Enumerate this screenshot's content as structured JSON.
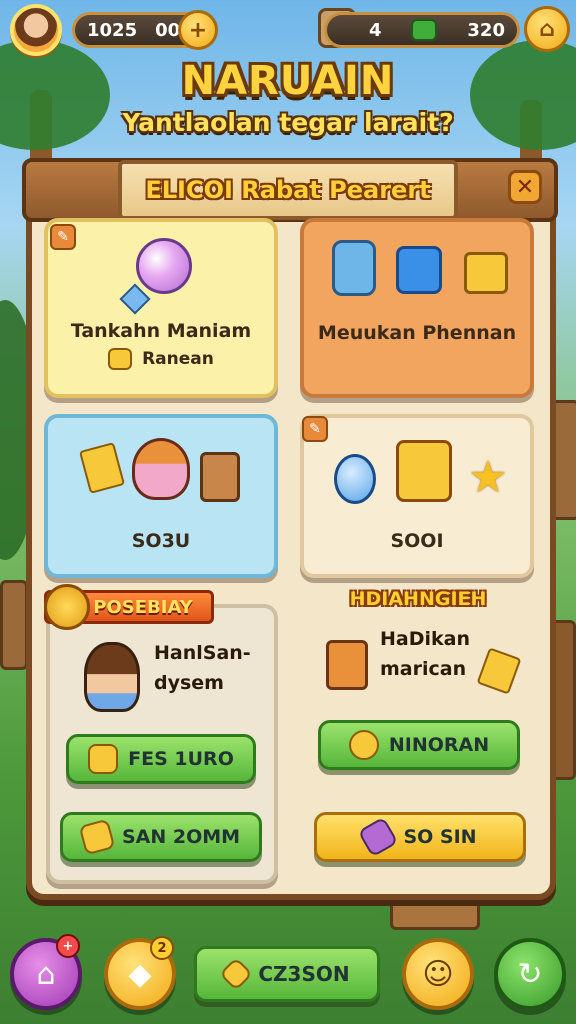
{
  "topbar": {
    "left_value_a": "1025",
    "left_value_b": "00",
    "left_add_icon": "plus-icon",
    "right_value_a": "4",
    "right_value_b": "320",
    "right_shop_icon": "shop-icon"
  },
  "title": "NARUAIN",
  "subtitle": "Yantlaolan tegar larait?",
  "panel": {
    "header": "ELICOI Rabat Pearert",
    "close_icon": "close-icon"
  },
  "cards": {
    "yellow": {
      "label": "Tankahn Maniam",
      "sublabel": "Ranean"
    },
    "orange": {
      "label": "Meuukan Phennan"
    },
    "blue": {
      "label": "SO3U"
    },
    "cream": {
      "label": "SOOI"
    }
  },
  "profile_card": {
    "ribbon": "POSEBIAY",
    "name_line1": "HanlSan-",
    "name_line2": "dysem",
    "btn1": "FES 1URO",
    "btn2": "SAN 2OMM"
  },
  "reward_section": {
    "heading": "HDIAHNGIEH",
    "line1": "HaDikan",
    "line2": "marican",
    "btn1": "NINORAN",
    "btn2": "SO SIN"
  },
  "bottom_nav": {
    "center_label": "CZ3SON",
    "home_badge": "+",
    "shop_badge": "2"
  },
  "colors": {
    "title_gold": "#ffd33d",
    "board": "#f3e6c9",
    "green_button": "#56b63a",
    "yellow_button": "#f2b51a"
  }
}
